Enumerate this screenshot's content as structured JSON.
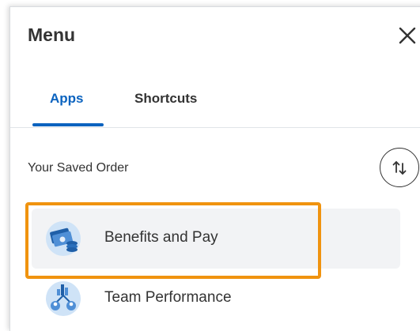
{
  "menu": {
    "title": "Menu"
  },
  "tabs": [
    {
      "label": "Apps",
      "active": true
    },
    {
      "label": "Shortcuts",
      "active": false
    }
  ],
  "saved_order": {
    "label": "Your Saved Order",
    "sort_icon": "sort-arrows-icon"
  },
  "apps": [
    {
      "label": "Benefits and Pay",
      "icon": "benefits-pay-icon",
      "selected": true
    },
    {
      "label": "Team Performance",
      "icon": "team-performance-icon",
      "selected": false
    }
  ],
  "colors": {
    "accent": "#0b63bf",
    "highlight": "#f0930f",
    "text": "#333333",
    "selected_bg": "#f2f3f5"
  }
}
